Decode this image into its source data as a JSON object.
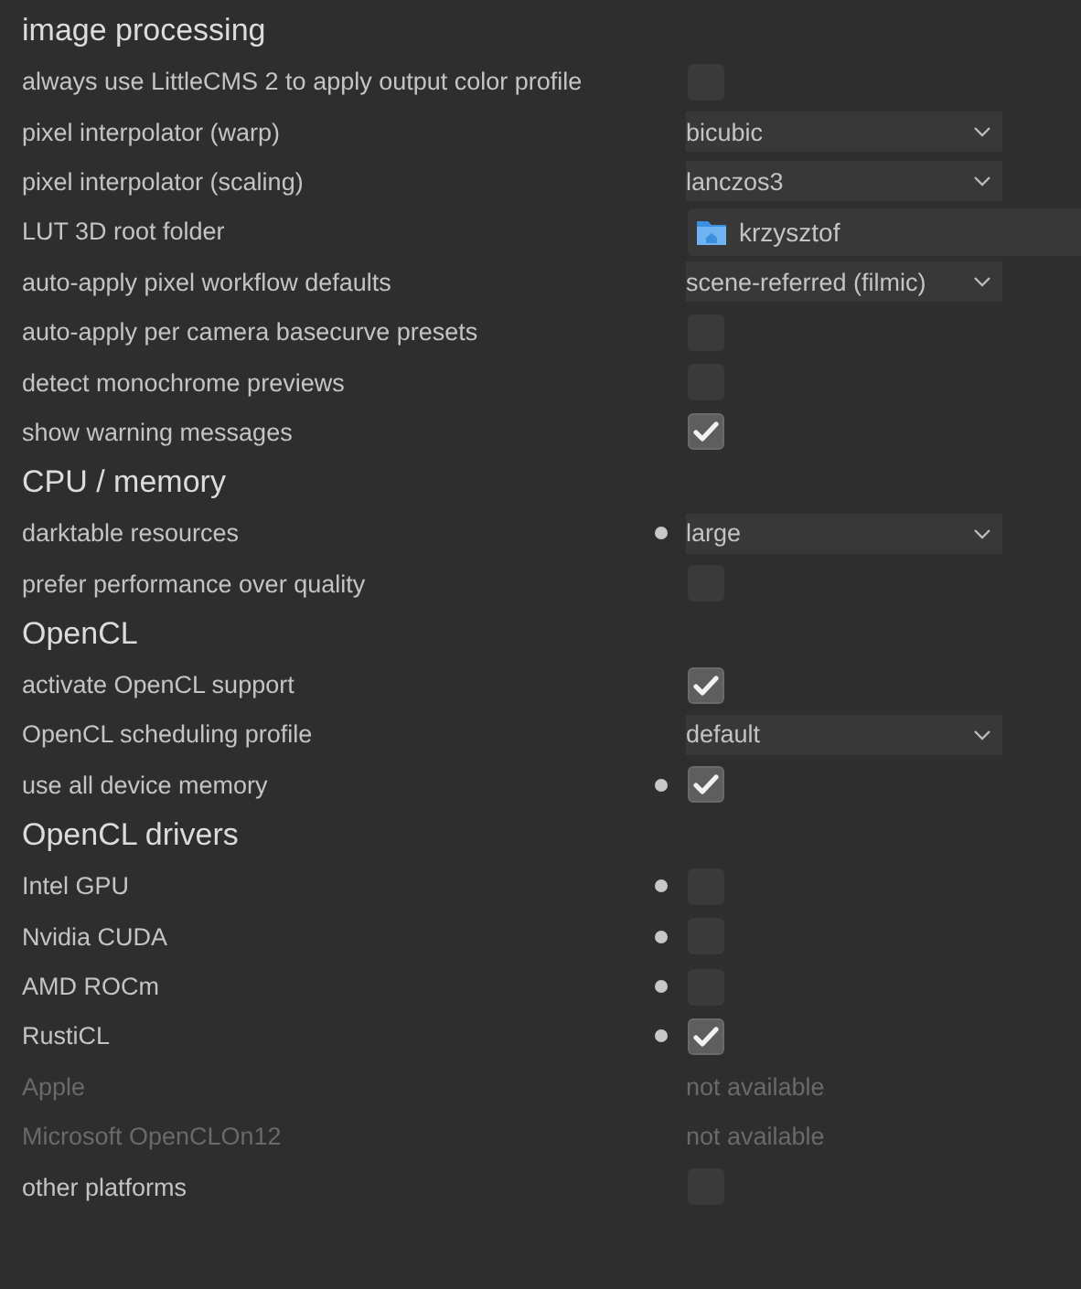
{
  "sections": [
    {
      "title": "image processing",
      "rows": [
        {
          "label": "always use LittleCMS 2 to apply output color profile",
          "kind": "checkbox",
          "checked": false,
          "modified": false
        },
        {
          "label": "pixel interpolator (warp)",
          "kind": "select",
          "value": "bicubic",
          "modified": false
        },
        {
          "label": "pixel interpolator (scaling)",
          "kind": "select",
          "value": "lanczos3",
          "modified": false
        },
        {
          "label": "LUT 3D root folder",
          "kind": "folder",
          "value": "krzysztof",
          "modified": false
        },
        {
          "label": "auto-apply pixel workflow defaults",
          "kind": "select",
          "value": "scene-referred (filmic)",
          "modified": false
        },
        {
          "label": "auto-apply per camera basecurve presets",
          "kind": "checkbox",
          "checked": false,
          "modified": false
        },
        {
          "label": "detect monochrome previews",
          "kind": "checkbox",
          "checked": false,
          "modified": false
        },
        {
          "label": "show warning messages",
          "kind": "checkbox",
          "checked": true,
          "modified": false
        }
      ]
    },
    {
      "title": "CPU / memory",
      "rows": [
        {
          "label": "darktable resources",
          "kind": "select",
          "value": "large",
          "modified": true
        },
        {
          "label": "prefer performance over quality",
          "kind": "checkbox",
          "checked": false,
          "modified": false
        }
      ]
    },
    {
      "title": "OpenCL",
      "rows": [
        {
          "label": "activate OpenCL support",
          "kind": "checkbox",
          "checked": true,
          "modified": false
        },
        {
          "label": "OpenCL scheduling profile",
          "kind": "select",
          "value": "default",
          "modified": false
        },
        {
          "label": "use all device memory",
          "kind": "checkbox",
          "checked": true,
          "modified": true
        }
      ]
    },
    {
      "title": "OpenCL drivers",
      "rows": [
        {
          "label": "Intel GPU",
          "kind": "checkbox",
          "checked": false,
          "modified": true
        },
        {
          "label": "Nvidia CUDA",
          "kind": "checkbox",
          "checked": false,
          "modified": true
        },
        {
          "label": "AMD ROCm",
          "kind": "checkbox",
          "checked": false,
          "modified": true
        },
        {
          "label": "RustiCL",
          "kind": "checkbox",
          "checked": true,
          "modified": true
        },
        {
          "label": "Apple",
          "kind": "text",
          "value": "not available",
          "disabled": true
        },
        {
          "label": "Microsoft OpenCLOn12",
          "kind": "text",
          "value": "not available",
          "disabled": true
        },
        {
          "label": "other platforms",
          "kind": "checkbox",
          "checked": false,
          "modified": false
        }
      ]
    }
  ]
}
